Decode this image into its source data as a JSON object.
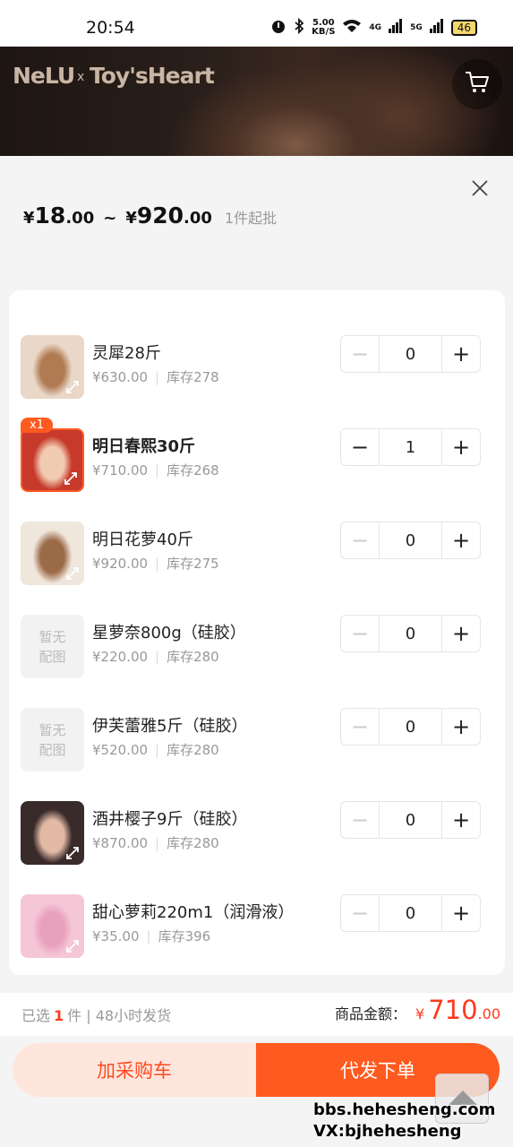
{
  "status_bar": {
    "time": "20:54",
    "net_speed_top": "5.00",
    "net_speed_bottom": "KB/S",
    "network_a": "4G",
    "network_b": "5G",
    "battery": "46"
  },
  "banner": {
    "logo": "NeLU",
    "x": "x",
    "brand": "Toy'sHeart"
  },
  "price": {
    "currency": "¥",
    "min_int": "18",
    "min_dec": ".00",
    "tilde": "~",
    "max_int": "920",
    "max_dec": ".00",
    "min_order": "1件起批"
  },
  "items": [
    {
      "name": "灵犀28斤",
      "price": "¥630.00",
      "stock": "库存278",
      "qty": "0",
      "selected": false,
      "image": "photo"
    },
    {
      "name": "明日春熙30斤",
      "price": "¥710.00",
      "stock": "库存268",
      "qty": "1",
      "selected": true,
      "badge": "x1",
      "image": "photo"
    },
    {
      "name": "明日花萝40斤",
      "price": "¥920.00",
      "stock": "库存275",
      "qty": "0",
      "selected": false,
      "image": "photo"
    },
    {
      "name": "星萝奈800g（硅胶）",
      "price": "¥220.00",
      "stock": "库存280",
      "qty": "0",
      "selected": false,
      "image": "placeholder",
      "placeholder_text": "暂无配图"
    },
    {
      "name": "伊芙蕾雅5斤（硅胶）",
      "price": "¥520.00",
      "stock": "库存280",
      "qty": "0",
      "selected": false,
      "image": "placeholder",
      "placeholder_text": "暂无配图"
    },
    {
      "name": "酒井樱子9斤（硅胶）",
      "price": "¥870.00",
      "stock": "库存280",
      "qty": "0",
      "selected": false,
      "image": "photo"
    },
    {
      "name": "甜心萝莉220m1（润滑液）",
      "price": "¥35.00",
      "stock": "库存396",
      "qty": "0",
      "selected": false,
      "image": "photo"
    }
  ],
  "stepper": {
    "minus": "−",
    "plus": "+"
  },
  "summary": {
    "selected_prefix": "已选",
    "selected_count": "1",
    "selected_suffix": "件 | 48小时发货",
    "amount_label": "商品金额：",
    "currency": "¥",
    "amount_int": "710",
    "amount_dec": ".00"
  },
  "actions": {
    "add_cart": "加采购车",
    "order": "代发下单"
  },
  "watermark": {
    "line1": "bbs.hehesheng.com",
    "line2": "VX:bjhehesheng"
  },
  "colors": {
    "accent": "#ff5a1f",
    "price_red": "#ff3a1f",
    "cart_button_bg": "#ffe6dd"
  }
}
